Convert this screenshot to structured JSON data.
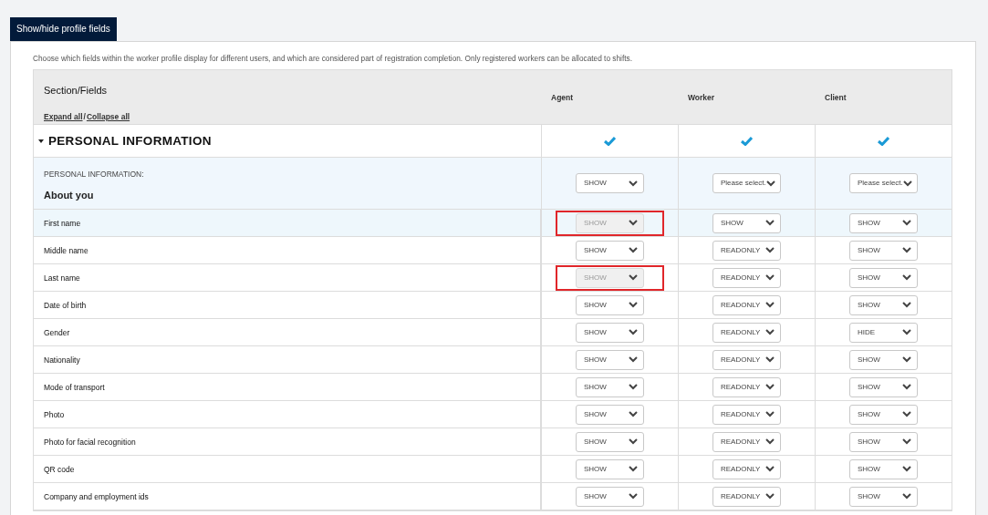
{
  "tab": {
    "label": "Show/hide profile fields",
    "selected": true
  },
  "description": "Choose which fields within the worker profile display for different users, and which are considered part of registration completion. Only registered workers can be allocated to shifts.",
  "table": {
    "first_column": "Section/Fields",
    "expand_all": "Expand all",
    "separator": "/",
    "collapse_all": "Collapse all",
    "columns": [
      "Agent",
      "Worker",
      "Client"
    ],
    "section": {
      "title": "PERSONAL INFORMATION",
      "expanded": true,
      "checks": [
        {
          "checked": true
        },
        {
          "checked": true
        },
        {
          "checked": true
        }
      ]
    },
    "subsection": {
      "label": "PERSONAL INFORMATION:",
      "title": "About you",
      "cells": [
        {
          "value": "SHOW",
          "disabled": false,
          "highlighted": false
        },
        {
          "value": "Please select.",
          "disabled": false,
          "highlighted": false
        },
        {
          "value": "Please select.",
          "disabled": false,
          "highlighted": false
        }
      ]
    },
    "rows": [
      {
        "name": "First name",
        "selected": true,
        "cells": [
          {
            "value": "SHOW",
            "disabled": true,
            "highlighted": true
          },
          {
            "value": "SHOW",
            "disabled": false,
            "highlighted": false
          },
          {
            "value": "SHOW",
            "disabled": false,
            "highlighted": false
          }
        ]
      },
      {
        "name": "Middle name",
        "selected": false,
        "cells": [
          {
            "value": "SHOW",
            "disabled": false,
            "highlighted": false
          },
          {
            "value": "READONLY",
            "disabled": false,
            "highlighted": false
          },
          {
            "value": "SHOW",
            "disabled": false,
            "highlighted": false
          }
        ]
      },
      {
        "name": "Last name",
        "selected": false,
        "cells": [
          {
            "value": "SHOW",
            "disabled": true,
            "highlighted": true
          },
          {
            "value": "READONLY",
            "disabled": false,
            "highlighted": false
          },
          {
            "value": "SHOW",
            "disabled": false,
            "highlighted": false
          }
        ]
      },
      {
        "name": "Date of birth",
        "selected": false,
        "cells": [
          {
            "value": "SHOW",
            "disabled": false,
            "highlighted": false
          },
          {
            "value": "READONLY",
            "disabled": false,
            "highlighted": false
          },
          {
            "value": "SHOW",
            "disabled": false,
            "highlighted": false
          }
        ]
      },
      {
        "name": "Gender",
        "selected": false,
        "cells": [
          {
            "value": "SHOW",
            "disabled": false,
            "highlighted": false
          },
          {
            "value": "READONLY",
            "disabled": false,
            "highlighted": false
          },
          {
            "value": "HIDE",
            "disabled": false,
            "highlighted": false
          }
        ]
      },
      {
        "name": "Nationality",
        "selected": false,
        "cells": [
          {
            "value": "SHOW",
            "disabled": false,
            "highlighted": false
          },
          {
            "value": "READONLY",
            "disabled": false,
            "highlighted": false
          },
          {
            "value": "SHOW",
            "disabled": false,
            "highlighted": false
          }
        ]
      },
      {
        "name": "Mode of transport",
        "selected": false,
        "cells": [
          {
            "value": "SHOW",
            "disabled": false,
            "highlighted": false
          },
          {
            "value": "READONLY",
            "disabled": false,
            "highlighted": false
          },
          {
            "value": "SHOW",
            "disabled": false,
            "highlighted": false
          }
        ]
      },
      {
        "name": "Photo",
        "selected": false,
        "cells": [
          {
            "value": "SHOW",
            "disabled": false,
            "highlighted": false
          },
          {
            "value": "READONLY",
            "disabled": false,
            "highlighted": false
          },
          {
            "value": "SHOW",
            "disabled": false,
            "highlighted": false
          }
        ]
      },
      {
        "name": "Photo for facial recognition",
        "selected": false,
        "cells": [
          {
            "value": "SHOW",
            "disabled": false,
            "highlighted": false
          },
          {
            "value": "READONLY",
            "disabled": false,
            "highlighted": false
          },
          {
            "value": "SHOW",
            "disabled": false,
            "highlighted": false
          }
        ]
      },
      {
        "name": "QR code",
        "selected": false,
        "cells": [
          {
            "value": "SHOW",
            "disabled": false,
            "highlighted": false
          },
          {
            "value": "READONLY",
            "disabled": false,
            "highlighted": false
          },
          {
            "value": "SHOW",
            "disabled": false,
            "highlighted": false
          }
        ]
      },
      {
        "name": "Company and employment ids",
        "selected": false,
        "cells": [
          {
            "value": "SHOW",
            "disabled": false,
            "highlighted": false
          },
          {
            "value": "READONLY",
            "disabled": false,
            "highlighted": false
          },
          {
            "value": "SHOW",
            "disabled": false,
            "highlighted": false
          }
        ]
      }
    ]
  }
}
